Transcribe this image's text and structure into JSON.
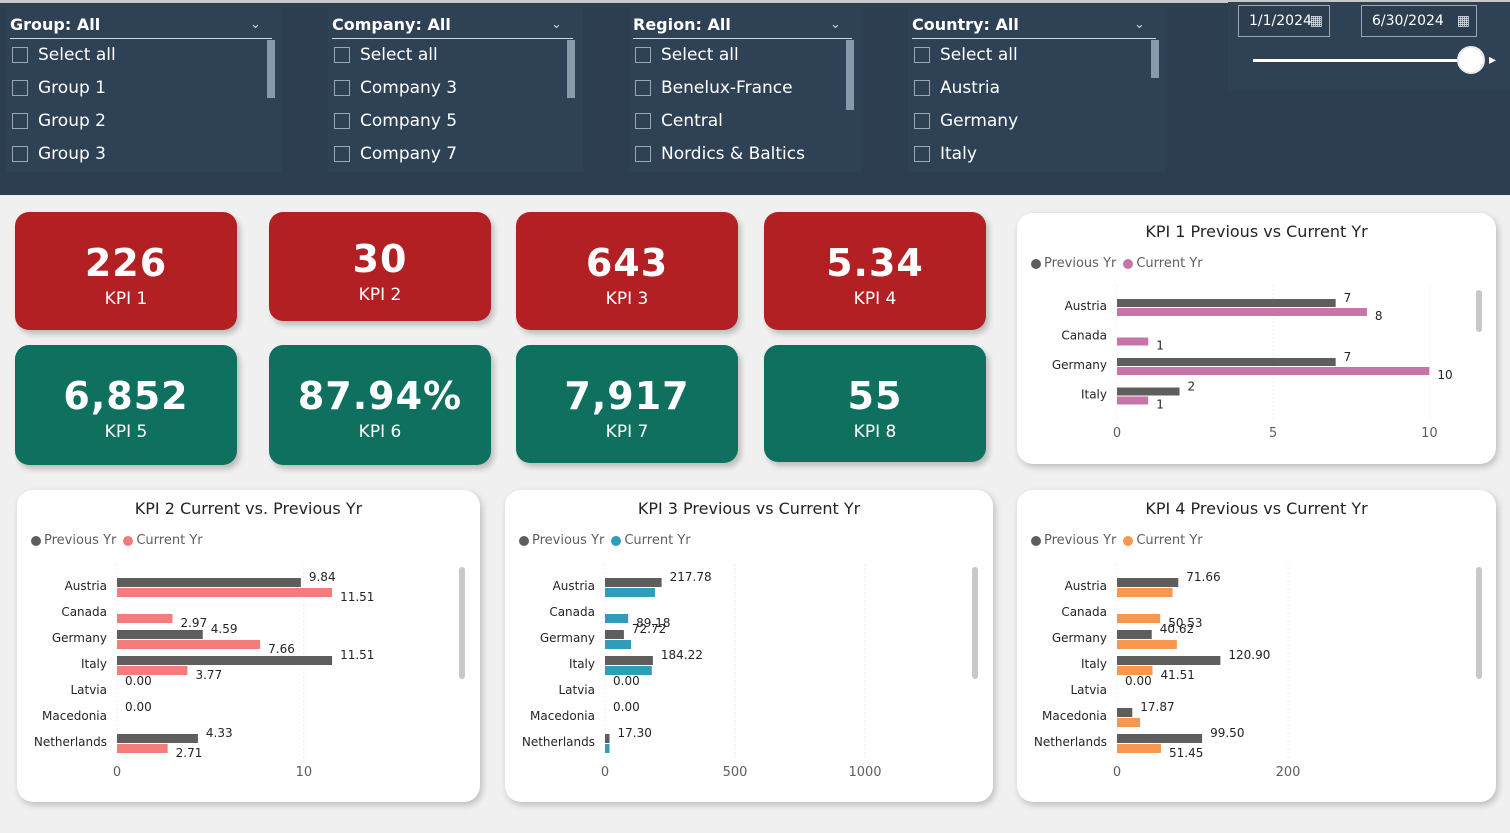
{
  "filters": {
    "group": {
      "title": "Group: All",
      "items": [
        "Select all",
        "Group 1",
        "Group 2",
        "Group 3"
      ]
    },
    "company": {
      "title": "Company: All",
      "items": [
        "Select all",
        "Company 3",
        "Company 5",
        "Company 7"
      ]
    },
    "region": {
      "title": "Region: All",
      "items": [
        "Select all",
        "Benelux-France",
        "Central",
        "Nordics & Baltics"
      ]
    },
    "country": {
      "title": "Country: All",
      "items": [
        "Select all",
        "Austria",
        "Germany",
        "Italy"
      ]
    }
  },
  "date_range": {
    "start": "1/1/2024",
    "end": "6/30/2024",
    "slider_position_pct": 100
  },
  "kpis": [
    {
      "value": "226",
      "label": "KPI 1",
      "status": "red"
    },
    {
      "value": "30",
      "label": "KPI 2",
      "status": "red"
    },
    {
      "value": "643",
      "label": "KPI 3",
      "status": "red"
    },
    {
      "value": "5.34",
      "label": "KPI 4",
      "status": "red"
    },
    {
      "value": "6,852",
      "label": "KPI 5",
      "status": "green"
    },
    {
      "value": "87.94%",
      "label": "KPI 6",
      "status": "green"
    },
    {
      "value": "7,917",
      "label": "KPI 7",
      "status": "green"
    },
    {
      "value": "55",
      "label": "KPI 8",
      "status": "green"
    }
  ],
  "colors": {
    "topbar": "#2c3e50",
    "kpi_red": "#b32024",
    "kpi_green": "#107060",
    "previous": "#605e5c",
    "kpi1_current": "#c774a9",
    "kpi2_current": "#f47c7c",
    "kpi3_current": "#2f9cb9",
    "kpi4_current": "#f79750"
  },
  "chart_data": [
    {
      "id": "kpi1",
      "type": "bar",
      "title": "KPI 1 Previous vs Current Yr",
      "legend": [
        "Previous Yr",
        "Current Yr"
      ],
      "categories": [
        "Austria",
        "Canada",
        "Germany",
        "Italy"
      ],
      "series": [
        {
          "name": "Previous Yr",
          "values": [
            7,
            null,
            7,
            2
          ],
          "labels": [
            "7",
            "",
            "7",
            "2"
          ]
        },
        {
          "name": "Current Yr",
          "values": [
            8,
            1,
            10,
            1
          ],
          "labels": [
            "8",
            "1",
            "10",
            "1"
          ]
        }
      ],
      "xlim": [
        0,
        10.5
      ],
      "xticks": [
        0,
        5,
        10
      ],
      "current_color": "#c774a9"
    },
    {
      "id": "kpi2",
      "type": "bar",
      "title": "KPI 2 Current vs. Previous Yr",
      "legend": [
        "Previous Yr",
        "Current Yr"
      ],
      "categories": [
        "Austria",
        "Canada",
        "Germany",
        "Italy",
        "Latvia",
        "Macedonia",
        "Netherlands"
      ],
      "series": [
        {
          "name": "Previous Yr",
          "values": [
            9.84,
            null,
            4.59,
            11.51,
            0,
            0,
            4.33
          ],
          "labels": [
            "9.84",
            "",
            "4.59",
            "11.51",
            "0.00",
            "0.00",
            "4.33"
          ]
        },
        {
          "name": "Current Yr",
          "values": [
            11.51,
            2.97,
            7.66,
            3.77,
            null,
            null,
            2.71
          ],
          "labels": [
            "11.51",
            "2.97",
            "7.66",
            "3.77",
            "",
            "",
            "2.71"
          ]
        }
      ],
      "xlim": [
        0,
        17.5
      ],
      "xticks": [
        0,
        10
      ],
      "current_color": "#f47c7c"
    },
    {
      "id": "kpi3",
      "type": "bar",
      "title": "KPI 3 Previous vs Current Yr",
      "legend": [
        "Previous Yr",
        "Current Yr"
      ],
      "categories": [
        "Austria",
        "Canada",
        "Germany",
        "Italy",
        "Latvia",
        "Macedonia",
        "Netherlands"
      ],
      "series": [
        {
          "name": "Previous Yr",
          "values": [
            217.78,
            null,
            72.72,
            184.22,
            0,
            0,
            17.3
          ],
          "labels": [
            "217.78",
            "",
            "72.72",
            "184.22",
            "0.00",
            "0.00",
            "17.30"
          ]
        },
        {
          "name": "Current Yr",
          "values": [
            192,
            89.18,
            100,
            180,
            null,
            null,
            17.3
          ],
          "labels": [
            "",
            "89.18",
            "",
            "",
            "",
            "",
            ""
          ]
        }
      ],
      "xlim": [
        0,
        1250
      ],
      "xticks": [
        0,
        500,
        1000
      ],
      "current_color": "#2f9cb9"
    },
    {
      "id": "kpi4",
      "type": "bar",
      "title": "KPI 4 Previous vs Current Yr",
      "legend": [
        "Previous Yr",
        "Current Yr"
      ],
      "categories": [
        "Austria",
        "Canada",
        "Germany",
        "Italy",
        "Latvia",
        "Macedonia",
        "Netherlands"
      ],
      "series": [
        {
          "name": "Previous Yr",
          "values": [
            71.66,
            null,
            40.62,
            120.9,
            0,
            17.87,
            99.5
          ],
          "labels": [
            "71.66",
            "",
            "40.62",
            "120.90",
            "0.00",
            "17.87",
            "99.50"
          ]
        },
        {
          "name": "Current Yr",
          "values": [
            65,
            50.53,
            70,
            41.51,
            null,
            27,
            51.45
          ],
          "labels": [
            "",
            "50.53",
            "",
            "41.51",
            "",
            "",
            "51.45"
          ]
        }
      ],
      "xlim": [
        0,
        380
      ],
      "xticks": [
        0,
        200
      ],
      "current_color": "#f79750"
    }
  ]
}
